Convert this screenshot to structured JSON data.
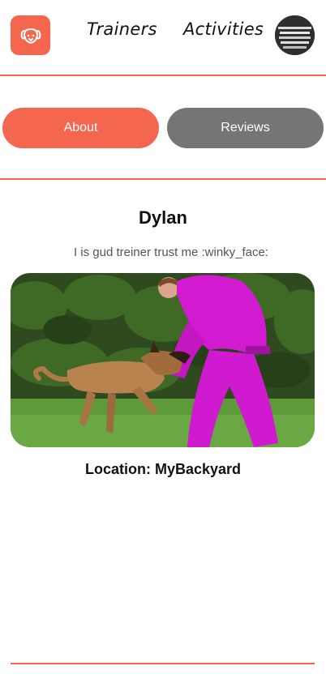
{
  "header": {
    "logo_icon": "dog-face-icon",
    "nav": [
      {
        "label": "Trainers"
      },
      {
        "label": "Activities"
      }
    ],
    "avatar_icon": "profile-avatar"
  },
  "tabs": [
    {
      "label": "About",
      "active": true
    },
    {
      "label": "Reviews",
      "active": false
    }
  ],
  "profile": {
    "name": "Dylan",
    "bio": "I is gud treiner trust me :winky_face:",
    "location": "Location: MyBackyard",
    "photo_icon": "dog-training-photo"
  },
  "colors": {
    "accent": "#f4664e",
    "inactive_tab": "#757575"
  }
}
